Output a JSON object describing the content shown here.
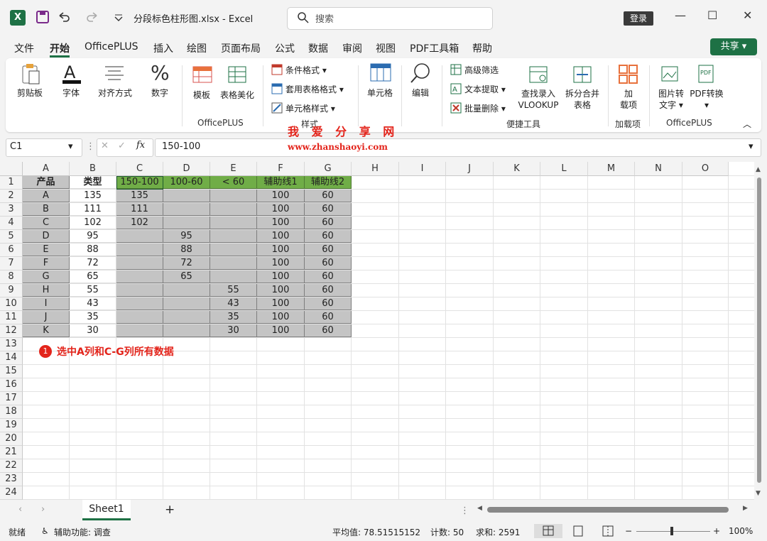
{
  "app": {
    "logo": "X",
    "file_title": "分段标色柱形图.xlsx  -  Excel",
    "search_placeholder": "搜索",
    "login_label": "登录",
    "window_controls": {
      "minimize": "—",
      "maximize": "☐",
      "close": "✕"
    }
  },
  "menu": {
    "items": [
      "文件",
      "开始",
      "OfficePLUS",
      "插入",
      "绘图",
      "页面布局",
      "公式",
      "数据",
      "审阅",
      "视图",
      "PDF工具箱",
      "帮助"
    ],
    "active": "开始",
    "share_label": "共享"
  },
  "ribbon": {
    "clipboard": "剪贴板",
    "font": "字体",
    "align": "对齐方式",
    "number": "数字",
    "template": "模板",
    "table_beautify": "表格美化",
    "group_officeplus": "OfficePLUS",
    "cond_format": "条件格式",
    "table_format": "套用表格格式",
    "cell_style": "单元格样式",
    "group_style": "样式",
    "cell": "单元格",
    "edit": "编辑",
    "adv_filter": "高级筛选",
    "text_extract": "文本提取",
    "batch_delete": "批量删除",
    "lookup_line1": "查找录入",
    "lookup_line2": "VLOOKUP",
    "split_merge_line1": "拆分合并",
    "split_merge_line2": "表格",
    "group_quick": "便捷工具",
    "addin_line1": "加",
    "addin_line2": "载项",
    "group_addin": "加载项",
    "pic2text_line1": "图片转",
    "pic2text_line2": "文字",
    "pdf_convert": "PDF转换",
    "group_officeplus2": "OfficePLUS"
  },
  "formula_bar": {
    "name_box": "C1",
    "fx": "fx",
    "formula": "150-100"
  },
  "watermark": {
    "line1": "我 爱 分 享 网",
    "line2": "www.zhanshaoyi.com"
  },
  "columns": [
    "A",
    "B",
    "C",
    "D",
    "E",
    "F",
    "G",
    "H",
    "I",
    "J",
    "K",
    "L",
    "M",
    "N",
    "O"
  ],
  "rows": [
    "1",
    "2",
    "3",
    "4",
    "5",
    "6",
    "7",
    "8",
    "9",
    "10",
    "11",
    "12",
    "13",
    "14",
    "15",
    "16",
    "17",
    "18",
    "19",
    "20",
    "21",
    "22",
    "23",
    "24"
  ],
  "table": {
    "header": [
      "产品",
      "类型",
      "150-100",
      "100-60",
      "< 60",
      "辅助线1",
      "辅助线2"
    ],
    "data": [
      [
        "A",
        "135",
        "135",
        "",
        "",
        "100",
        "60"
      ],
      [
        "B",
        "111",
        "111",
        "",
        "",
        "100",
        "60"
      ],
      [
        "C",
        "102",
        "102",
        "",
        "",
        "100",
        "60"
      ],
      [
        "D",
        "95",
        "",
        "95",
        "",
        "100",
        "60"
      ],
      [
        "E",
        "88",
        "",
        "88",
        "",
        "100",
        "60"
      ],
      [
        "F",
        "72",
        "",
        "72",
        "",
        "100",
        "60"
      ],
      [
        "G",
        "65",
        "",
        "65",
        "",
        "100",
        "60"
      ],
      [
        "H",
        "55",
        "",
        "",
        "55",
        "100",
        "60"
      ],
      [
        "I",
        "43",
        "",
        "",
        "43",
        "100",
        "60"
      ],
      [
        "J",
        "35",
        "",
        "",
        "35",
        "100",
        "60"
      ],
      [
        "K",
        "30",
        "",
        "",
        "30",
        "100",
        "60"
      ]
    ]
  },
  "annotation": {
    "number": "1",
    "text": "选中A列和C-G列所有数据"
  },
  "sheet_tabs": {
    "active": "Sheet1",
    "add": "+"
  },
  "status": {
    "ready": "就绪",
    "accessibility": "辅助功能: 调查",
    "average": "平均值: 78.51515152",
    "count": "计数: 50",
    "sum": "求和: 2591",
    "zoom": "100%"
  },
  "colors": {
    "accent": "#1e7145",
    "selection": "#c4c4c4",
    "header_green": "#70ad47",
    "annotation_red": "#e3241b"
  }
}
